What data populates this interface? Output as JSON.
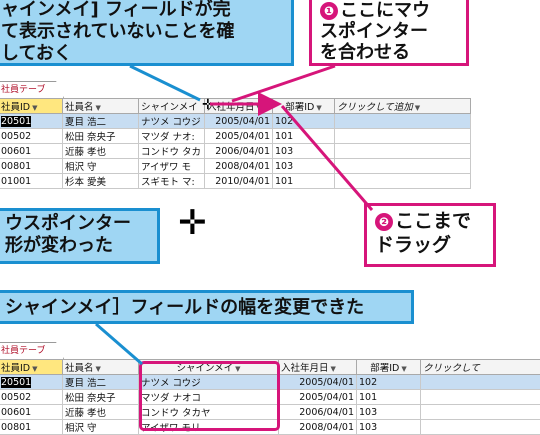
{
  "callouts": {
    "top_left_lines": [
      "ャインメイ] フィールドが完",
      "て表示されていないことを確",
      "しておく"
    ],
    "step1_badge": "❶",
    "step1_lines": [
      "ここにマウ",
      "スポインター",
      "を合わせる"
    ],
    "step2_badge": "❷",
    "step2_lines": [
      "ここまで",
      "ドラッグ"
    ],
    "mid_left_lines": [
      "ウスポインター",
      "形が変わった"
    ],
    "result": "シャインメイ］フィールドの幅を変更できた"
  },
  "cursor_glyph": "✛",
  "table_tab_label": "社員テーブル",
  "before_table": {
    "headers": [
      "社員ID",
      "社員名",
      "シャインメイ",
      "入社年月日",
      "部署ID",
      "クリックして追加"
    ],
    "rows": [
      [
        "20501",
        "夏目 浩二",
        "ナツメ コウジ",
        "2005/04/01",
        "102"
      ],
      [
        "00502",
        "松田 奈央子",
        "マツダ ナオ:",
        "2005/04/01",
        "101"
      ],
      [
        "00601",
        "近藤 孝也",
        "コンドウ タカ",
        "2006/04/01",
        "103"
      ],
      [
        "00801",
        "相沢 守",
        "アイザワ モ",
        "2008/04/01",
        "103"
      ],
      [
        "01001",
        "杉本 愛美",
        "スギモト マ:",
        "2010/04/01",
        "101"
      ]
    ]
  },
  "after_table": {
    "headers": [
      "社員ID",
      "社員名",
      "シャインメイ",
      "入社年月日",
      "部署ID",
      "クリックして"
    ],
    "rows": [
      [
        "20501",
        "夏目 浩二",
        "ナツメ コウジ",
        "2005/04/01",
        "102"
      ],
      [
        "00502",
        "松田 奈央子",
        "マツダ ナオコ",
        "2005/04/01",
        "101"
      ],
      [
        "00601",
        "近藤 孝也",
        "コンドウ タカヤ",
        "2006/04/01",
        "103"
      ],
      [
        "00801",
        "相沢 守",
        "アイザワ モリ",
        "2008/04/01",
        "103"
      ]
    ]
  },
  "colors": {
    "blue_border": "#1a8fd0",
    "blue_fill": "#9fd6f3",
    "pink": "#d6157a",
    "selected_row": "#c7ddf2"
  }
}
